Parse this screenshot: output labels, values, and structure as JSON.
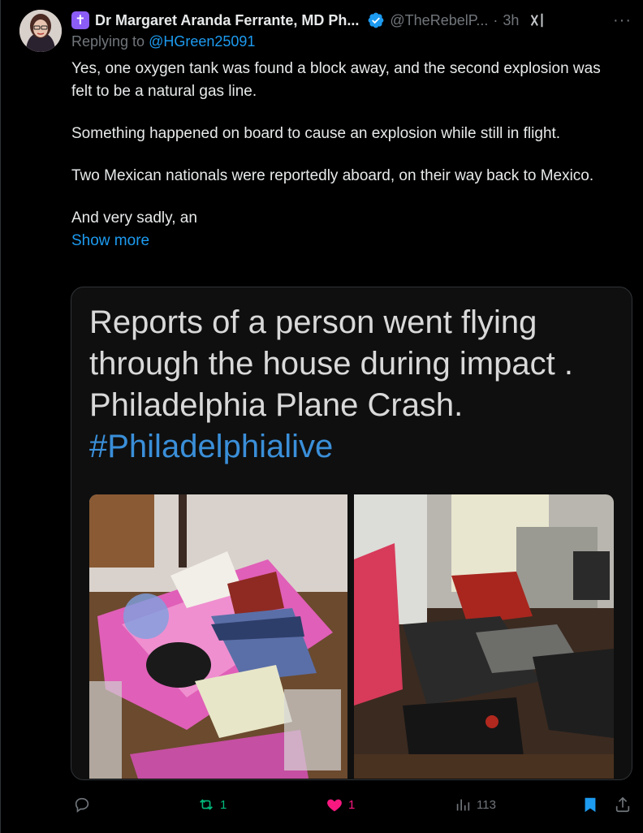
{
  "post": {
    "author_name": "Dr Margaret Aranda Ferrante, MD Ph...",
    "author_handle": "@TheRebelP...",
    "separator": "·",
    "time": "3h",
    "replying_prefix": "Replying to ",
    "replying_handle": "@HGreen25091",
    "paragraphs": [
      "Yes, one oxygen tank was found a block away, and the second explosion was felt to be a natural gas line.",
      "Something happened on board to cause an explosion while still in flight.",
      "Two Mexican nationals were reportedly aboard, on their way back to Mexico.",
      "And very sadly, an"
    ],
    "show_more": "Show more",
    "badge_symbol": "✝"
  },
  "media": {
    "caption_lines": [
      "Reports of a person went flying",
      "through the house during impact .",
      "Philadelphia Plane Crash."
    ],
    "hashtag": "#Philadelphialive"
  },
  "actions": {
    "reply_count": "",
    "repost_count": "1",
    "like_count": "1",
    "views_count": "113"
  },
  "colors": {
    "accent": "#1d9bf0",
    "repost": "#00ba7c",
    "like": "#f91880",
    "muted": "#71767b"
  }
}
